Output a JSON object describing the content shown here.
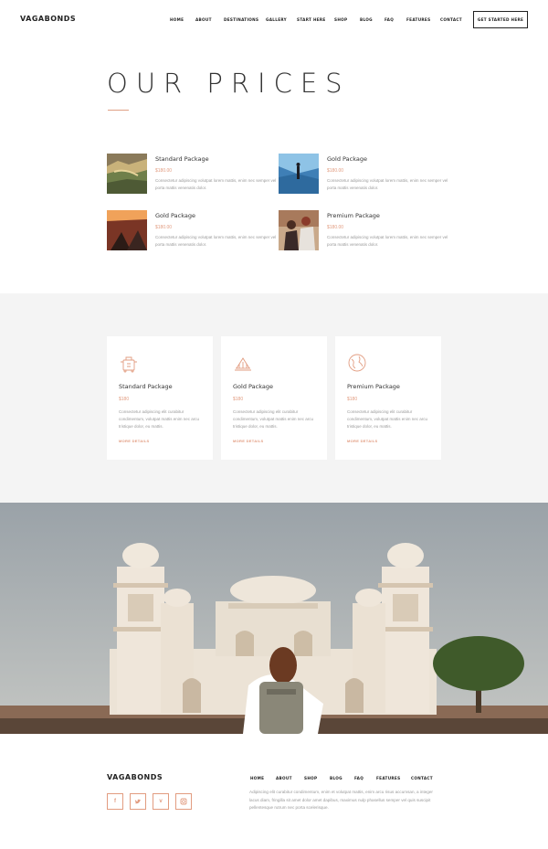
{
  "brand": "VAGABONDS",
  "nav": [
    "HOME",
    "ABOUT",
    "DESTINATIONS",
    "GALLERY",
    "START HERE",
    "SHOP",
    "BLOG",
    "FAQ",
    "FEATURES",
    "CONTACT"
  ],
  "cta": "GET STARTED HERE",
  "title": "OUR PRICES",
  "price_list": [
    {
      "name": "Standard Package",
      "price": "$180.00",
      "desc": "Consectetur adipiscing volutpat lorem mattis, enim nec semper vel porta mattis venenatis dolor.",
      "thumb": "landscape-photo"
    },
    {
      "name": "Gold Package",
      "price": "$180.00",
      "desc": "Consectetur adipiscing volutpat lorem mattis, enim nec semper vel porta mattis venenatis dolor.",
      "thumb": "ice-photo"
    },
    {
      "name": "Gold Package",
      "price": "$180.00",
      "desc": "Consectetur adipiscing volutpat lorem mattis, enim nec semper vel porta mattis venenatis dolor.",
      "thumb": "sunset-photo"
    },
    {
      "name": "Premium Package",
      "price": "$180.00",
      "desc": "Consectetur adipiscing volutpat lorem mattis, enim nec semper vel porta mattis venenatis dolor.",
      "thumb": "couple-photo"
    }
  ],
  "cards": [
    {
      "name": "Standard Package",
      "price": "$180",
      "desc": "Consectetur adipiscing elit curabitur condimentum, volutpat mattis enim nec arcu tristique dolor, eu mattis.",
      "link": "MORE DETAILS",
      "icon": "luggage-icon"
    },
    {
      "name": "Gold Package",
      "price": "$180",
      "desc": "Consectetur adipiscing elit curabitur condimentum, volutpat mattis enim nec arcu tristique dolor, eu mattis.",
      "link": "MORE DETAILS",
      "icon": "temple-icon"
    },
    {
      "name": "Premium Package",
      "price": "$180",
      "desc": "Consectetur adipiscing elit curabitur condimentum, volutpat mattis enim nec arcu tristique dolor, eu mattis.",
      "link": "MORE DETAILS",
      "icon": "globe-icon"
    }
  ],
  "footer": {
    "brand": "VAGABONDS",
    "social": [
      "facebook-icon",
      "twitter-icon",
      "vimeo-icon",
      "instagram-icon"
    ],
    "nav": [
      "HOME",
      "ABOUT",
      "SHOP",
      "BLOG",
      "FAQ",
      "FEATURES",
      "CONTACT"
    ],
    "desc": "Adipiscing elit curabitur condimentum, enim et volutpat mattis, enim arcu risus accumsan, a integer lacus diam, fringilla sit amet dolor amet dapibus, maximus nulp phasellus semper vel quis suscipit pellentesque rutrum nec porta scelerisque."
  },
  "colors": {
    "accent": "#e29c80",
    "text": "#333333",
    "muted": "#9a9a9a",
    "gray_bg": "#f4f4f4"
  }
}
